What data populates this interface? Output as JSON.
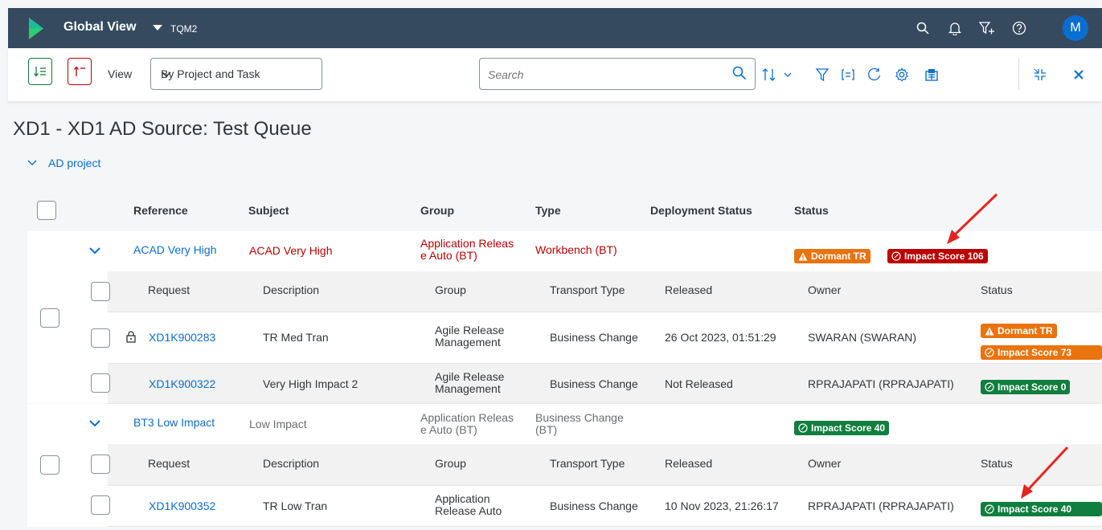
{
  "shell": {
    "title": "Global View",
    "subtitle": "TQM2",
    "avatar": "M"
  },
  "toolbar": {
    "view_label": "View",
    "view_select": "By Project and Task",
    "search_placeholder": "Search"
  },
  "page": {
    "title": "XD1 - XD1 AD Source: Test Queue",
    "project": "AD project"
  },
  "columns": {
    "reference": "Reference",
    "subject": "Subject",
    "group": "Group",
    "type": "Type",
    "deployment_status": "Deployment Status",
    "status": "Status"
  },
  "sub_columns": {
    "request": "Request",
    "description": "Description",
    "group": "Group",
    "transport_type": "Transport Type",
    "released": "Released",
    "owner": "Owner",
    "status": "Status"
  },
  "tasks": [
    {
      "reference": "ACAD Very High",
      "subject": "ACAD Very High",
      "group_line1": "Application Releas",
      "group_line2": "e Auto (BT)",
      "type_line1": "Workbench (BT)",
      "type_line2": "",
      "badge_dormant": "Dormant TR",
      "badge_impact": "Impact Score 106",
      "requests": [
        {
          "request": "XD1K900283",
          "description": "TR Med Tran",
          "group_line1": "Agile Release",
          "group_line2": "Management",
          "transport_type": "Business Change",
          "released": "26 Oct 2023, 01:51:29",
          "owner": "SWARAN (SWARAN)",
          "badge_dormant": "Dormant TR",
          "badge_impact": "Impact Score 73"
        },
        {
          "request": "XD1K900322",
          "description": "Very High Impact 2",
          "group_line1": "Agile Release",
          "group_line2": "Management",
          "transport_type": "Business Change",
          "released": "Not Released",
          "owner": "RPRAJAPATI (RPRAJAPATI)",
          "badge_impact": "Impact Score 0"
        }
      ]
    },
    {
      "reference": "BT3 Low Impact",
      "subject": "Low Impact",
      "group_line1": "Application Releas",
      "group_line2": "e Auto (BT)",
      "type_line1": "Business Change",
      "type_line2": "(BT)",
      "badge_impact": "Impact Score 40",
      "requests": [
        {
          "request": "XD1K900352",
          "description": "TR Low Tran",
          "group_line1": "Application",
          "group_line2": "Release Auto",
          "transport_type": "Business Change",
          "released": "10 Nov 2023, 21:26:17",
          "owner": "RPRAJAPATI (RPRAJAPATI)",
          "badge_impact": "Impact Score 40"
        }
      ]
    }
  ],
  "colors": {
    "shell": "#354a5f",
    "link": "#0a6ed1",
    "critical": "#bb0000",
    "warning": "#e9730c",
    "positive": "#107e3e"
  }
}
